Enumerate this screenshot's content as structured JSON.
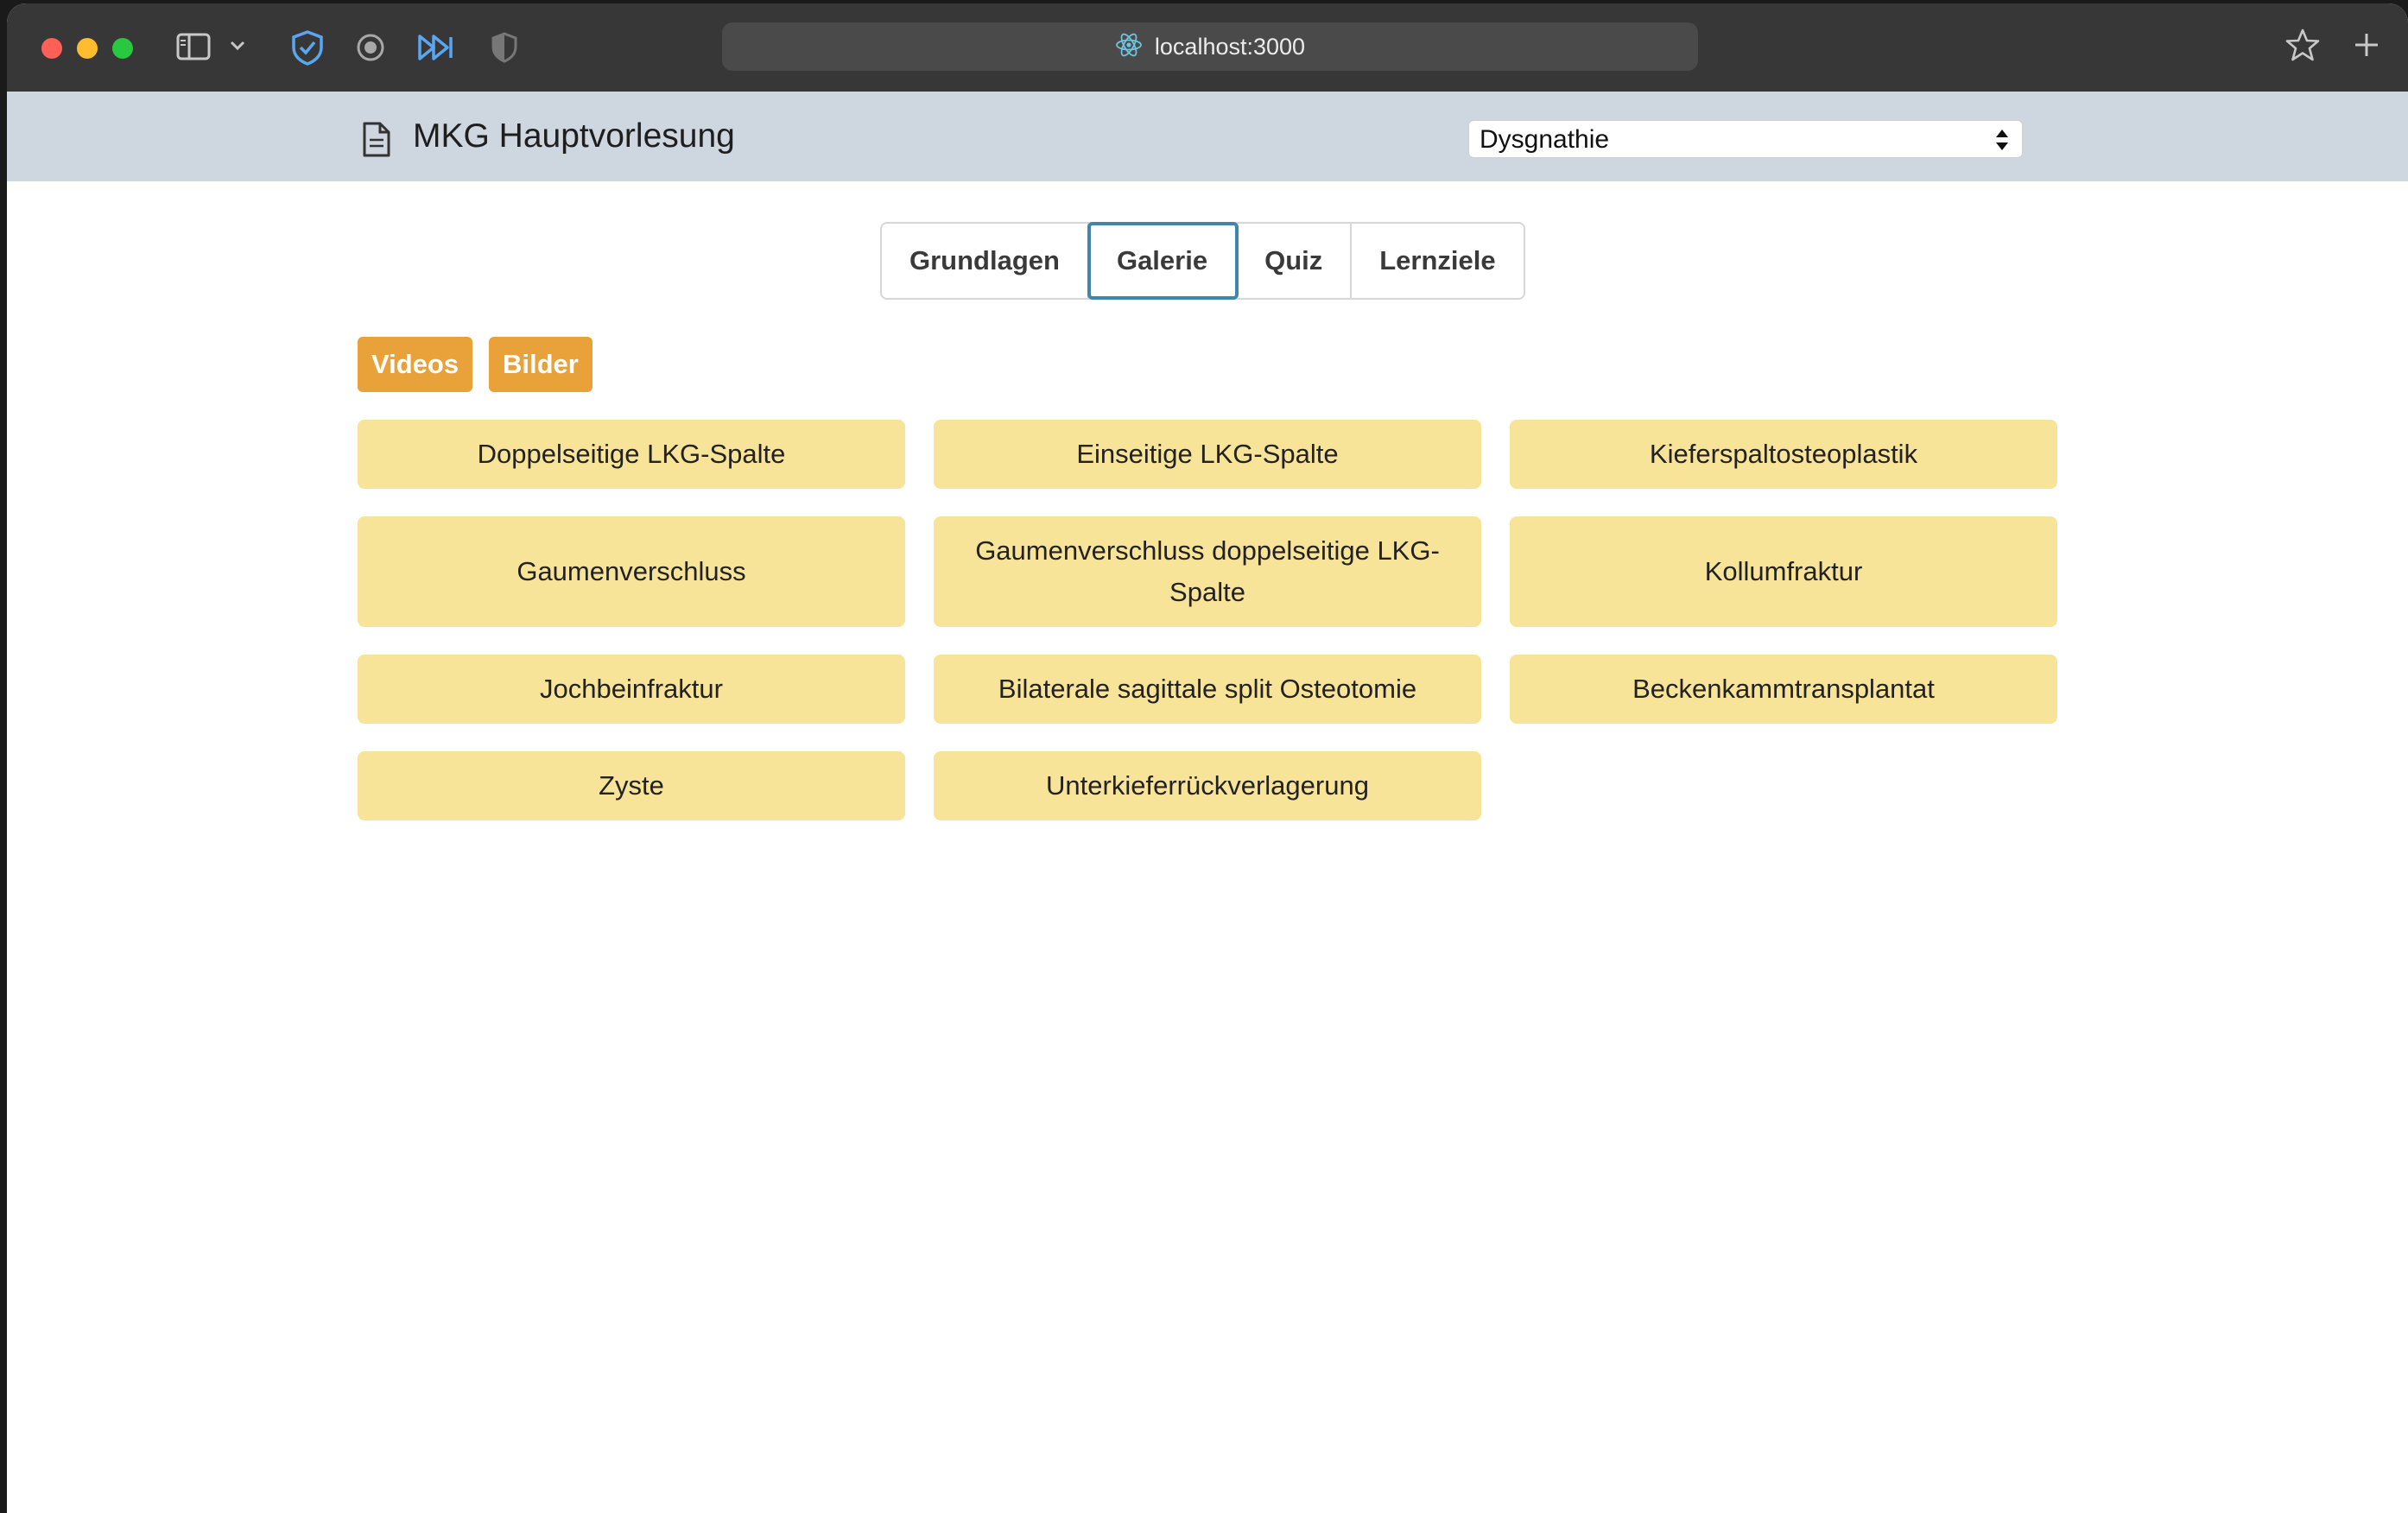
{
  "browser": {
    "url": "localhost:3000"
  },
  "header": {
    "title": "MKG Hauptvorlesung",
    "topic_select": {
      "selected": "Dysgnathie"
    }
  },
  "tabs": [
    {
      "label": "Grundlagen",
      "active": false
    },
    {
      "label": "Galerie",
      "active": true
    },
    {
      "label": "Quiz",
      "active": false
    },
    {
      "label": "Lernziele",
      "active": false
    }
  ],
  "filters": [
    {
      "label": "Videos"
    },
    {
      "label": "Bilder"
    }
  ],
  "gallery": {
    "items": [
      {
        "label": "Doppelseitige LKG-Spalte"
      },
      {
        "label": "Einseitige LKG-Spalte"
      },
      {
        "label": "Kieferspaltosteoplastik"
      },
      {
        "label": "Gaumenverschluss"
      },
      {
        "label": "Gaumenverschluss doppelseitige LKG-Spalte"
      },
      {
        "label": "Kollumfraktur"
      },
      {
        "label": "Jochbeinfraktur"
      },
      {
        "label": "Bilaterale sagittale split Osteotomie"
      },
      {
        "label": "Beckenkammtransplantat"
      },
      {
        "label": "Zyste"
      },
      {
        "label": "Unterkieferrückverlagerung"
      }
    ]
  },
  "colors": {
    "header_bg": "#ced6e0",
    "card_bg": "#f8e499",
    "filter_bg": "#e9a23a",
    "active_tab_outline": "#3f86a8"
  }
}
